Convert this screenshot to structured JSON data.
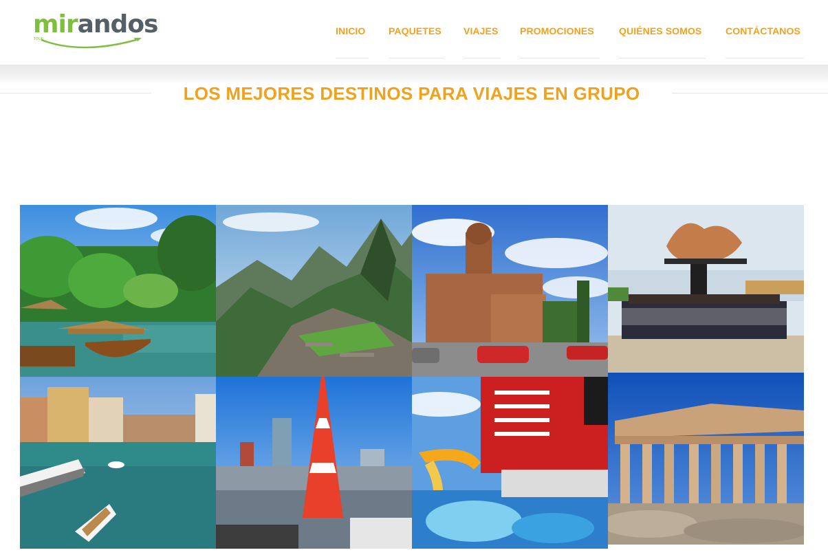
{
  "logo": {
    "text_left": "mir",
    "text_mid": "and",
    "text_o": "o",
    "text_right": "s",
    "tagline": "TOUR"
  },
  "nav": {
    "items": [
      "INICIO",
      "PAQUETES",
      "VIAJES",
      "PROMOCIONES",
      "QUIÉNES SOMOS",
      "CONTÁCTANOS"
    ]
  },
  "section": {
    "title": "LOS MEJORES DESTINOS PARA VIAJES EN GRUPO"
  },
  "colors": {
    "accent": "#f0a21e",
    "logo_green": "#7fbf3f",
    "logo_gray": "#555f66"
  },
  "gallery": {
    "items": [
      "tropical-river-boats",
      "machu-picchu",
      "colonial-cathedral",
      "love-park-group",
      "venice-grand-canal",
      "tokyo-tower",
      "cruise-ship-deck",
      "parthenon"
    ]
  }
}
